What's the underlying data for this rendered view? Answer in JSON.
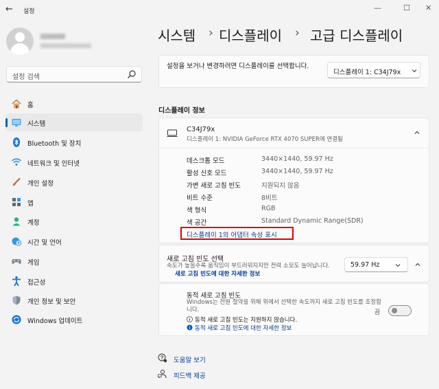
{
  "window": {
    "title": "설정",
    "back_glyph": "←",
    "min_glyph": "—",
    "max_glyph": "☐",
    "close_glyph": "✕"
  },
  "search": {
    "placeholder": "설정 검색"
  },
  "nav": {
    "items": [
      {
        "label": "홈",
        "icon": "home-icon"
      },
      {
        "label": "시스템",
        "icon": "system-icon",
        "active": true
      },
      {
        "label": "Bluetooth 및 장치",
        "icon": "bluetooth-icon"
      },
      {
        "label": "네트워크 및 인터넷",
        "icon": "network-icon"
      },
      {
        "label": "개인 설정",
        "icon": "brush-icon"
      },
      {
        "label": "앱",
        "icon": "apps-icon"
      },
      {
        "label": "계정",
        "icon": "account-icon"
      },
      {
        "label": "시간 및 언어",
        "icon": "time-language-icon"
      },
      {
        "label": "게임",
        "icon": "gaming-icon"
      },
      {
        "label": "접근성",
        "icon": "accessibility-icon"
      },
      {
        "label": "개인 정보 및 보안",
        "icon": "shield-icon"
      },
      {
        "label": "Windows 업데이트",
        "icon": "update-icon"
      }
    ]
  },
  "breadcrumb": {
    "items": [
      "시스템",
      "디스플레이",
      "고급 디스플레이"
    ],
    "separator": "›"
  },
  "display_select": {
    "text": "설정을 보거나 변경하려면 디스플레이를 선택합니다.",
    "value": "디스플레이 1: C34J79x"
  },
  "display_info": {
    "section_title": "디스플레이 정보",
    "monitor_name": "C34J79x",
    "monitor_sub": "디스플레이 1: NVIDIA GeForce RTX 4070 SUPER에 연결됨",
    "properties": [
      {
        "label": "데스크톱 모드",
        "value": "3440×1440, 59.97 Hz"
      },
      {
        "label": "활성 신호 모드",
        "value": "3440×1440, 59.97 Hz"
      },
      {
        "label": "가변 새로 고침 빈도",
        "value": "지원되지 않음"
      },
      {
        "label": "비트 수준",
        "value": "8비트"
      },
      {
        "label": "색 형식",
        "value": "RGB"
      },
      {
        "label": "색 공간",
        "value": "Standard Dynamic Range(SDR)"
      }
    ],
    "adapter_link": "디스플레이 1의 어댑터 속성 표시"
  },
  "refresh_rate": {
    "title": "새로 고침 빈도 선택",
    "desc": "속도가 높을수록 움직임이 부드러워지지만 전력 소모도 늘어납니다.",
    "link": "새로 고침 빈도에 대한 자세한 정보",
    "value": "59.97 Hz"
  },
  "dynamic_refresh": {
    "title": "동적 새로 고침 빈도",
    "desc": "Windows는 전원 절약을 위해 위에서 선택한 속도까지 새로 고침 빈도를 조정합니다.",
    "note": "동적 새로 고침 빈도는 지원하지 않습니다.",
    "link": "동적 새로 고침 빈도에 대한 자세한 정보",
    "toggle_label": "끔",
    "enabled": false
  },
  "footer": {
    "help": "도움말 보기",
    "feedback": "피드백 제공"
  },
  "colors": {
    "accent": "#005fb8",
    "link": "#003e92",
    "highlight": "#e00000"
  }
}
